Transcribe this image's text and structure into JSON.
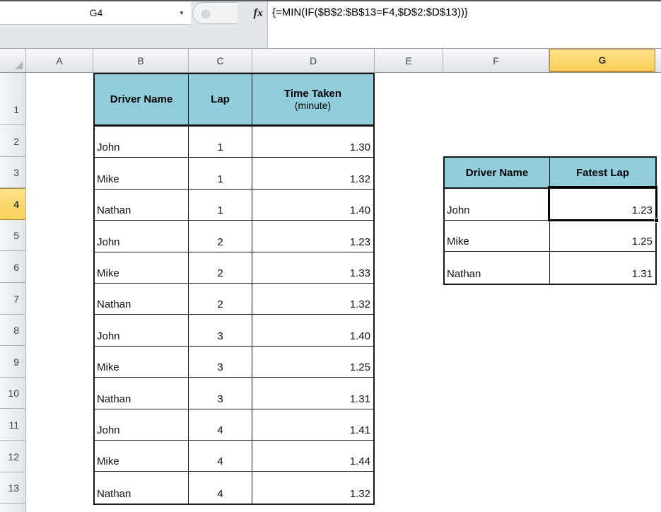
{
  "chrome": {
    "name_box": "G4",
    "fx_label": "fx",
    "formula": "{=MIN(IF($B$2:$B$13=F4,$D$2:$D$13))}"
  },
  "icons": {
    "dropdown": "▼"
  },
  "grid": {
    "column_headers": [
      {
        "label": "A"
      },
      {
        "label": "B"
      },
      {
        "label": "C"
      },
      {
        "label": "D"
      },
      {
        "label": "E"
      },
      {
        "label": "F"
      },
      {
        "label": "G",
        "selected": true
      }
    ],
    "row_headers": [
      {
        "label": "1"
      },
      {
        "label": "2"
      },
      {
        "label": "3"
      },
      {
        "label": "4",
        "selected": true
      },
      {
        "label": "5"
      },
      {
        "label": "6"
      },
      {
        "label": "7"
      },
      {
        "label": "8"
      },
      {
        "label": "9"
      },
      {
        "label": "10"
      },
      {
        "label": "11"
      },
      {
        "label": "12"
      },
      {
        "label": "13"
      }
    ]
  },
  "lap_table": {
    "header": {
      "driver": "Driver Name",
      "lap": "Lap",
      "time_line1": "Time Taken",
      "time_line2": "(minute)"
    },
    "rows": [
      {
        "driver": "John",
        "lap": "1",
        "time": "1.30"
      },
      {
        "driver": "Mike",
        "lap": "1",
        "time": "1.32"
      },
      {
        "driver": "Nathan",
        "lap": "1",
        "time": "1.40"
      },
      {
        "driver": "John",
        "lap": "2",
        "time": "1.23"
      },
      {
        "driver": "Mike",
        "lap": "2",
        "time": "1.33"
      },
      {
        "driver": "Nathan",
        "lap": "2",
        "time": "1.32"
      },
      {
        "driver": "John",
        "lap": "3",
        "time": "1.40"
      },
      {
        "driver": "Mike",
        "lap": "3",
        "time": "1.25"
      },
      {
        "driver": "Nathan",
        "lap": "3",
        "time": "1.31"
      },
      {
        "driver": "John",
        "lap": "4",
        "time": "1.41"
      },
      {
        "driver": "Mike",
        "lap": "4",
        "time": "1.44"
      },
      {
        "driver": "Nathan",
        "lap": "4",
        "time": "1.32"
      }
    ]
  },
  "result_table": {
    "header": {
      "driver": "Driver Name",
      "fastest": "Fatest Lap"
    },
    "rows": [
      {
        "driver": "John",
        "time": "1.23",
        "active": true
      },
      {
        "driver": "Mike",
        "time": "1.25"
      },
      {
        "driver": "Nathan",
        "time": "1.31"
      }
    ]
  },
  "colors": {
    "teal_header": "#92CDDC",
    "selected_hdr_fill_top": "#FEE088",
    "selected_hdr_fill_bottom": "#FBD05A",
    "selected_hdr_border": "#C08A35",
    "table_border": "#151515"
  }
}
